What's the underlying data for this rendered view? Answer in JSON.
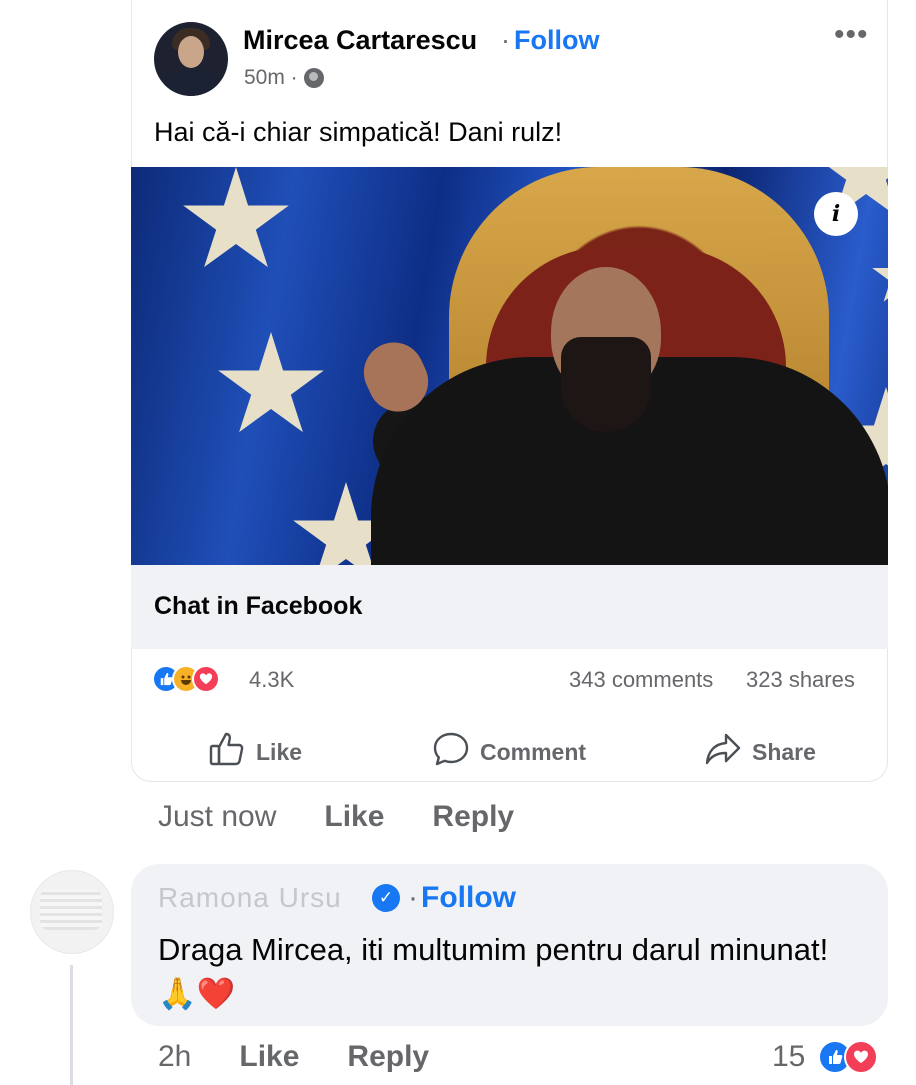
{
  "post": {
    "author": "Mircea Cartarescu",
    "separator": "·",
    "follow_label": "Follow",
    "time": "50m ·",
    "more_label": "•••",
    "text": "Hai că-i chiar simpatică! Dani rulz!",
    "info_label": "i",
    "link_title": "Chat in Facebook",
    "reactions": {
      "icons": [
        "like-icon",
        "haha-icon",
        "love-icon"
      ],
      "count": "4.3K"
    },
    "comments_count": "343 comments",
    "shares_count": "323 shares",
    "actions": {
      "like": "Like",
      "comment": "Comment",
      "share": "Share"
    }
  },
  "own_comment_meta": {
    "time": "Just now",
    "like": "Like",
    "reply": "Reply"
  },
  "comment": {
    "author": "Ramona Ursu",
    "verified_icon": "✓",
    "separator": "·",
    "follow_label": "Follow",
    "text": "Draga Mircea, iti multumim pentru darul minunat! 🙏❤️",
    "time": "2h",
    "like": "Like",
    "reply": "Reply",
    "reaction_count": "15",
    "reaction_icons": [
      "like-icon",
      "love-icon"
    ]
  },
  "colors": {
    "accent": "#1877f2",
    "secondary_text": "#65676b",
    "bubble_bg": "#f0f2f5",
    "love": "#f33e58",
    "haha": "#f7b125"
  }
}
